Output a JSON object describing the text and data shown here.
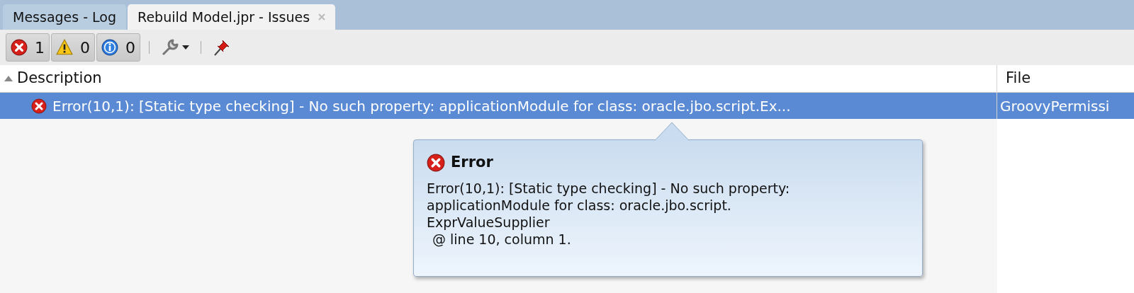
{
  "tabs": [
    {
      "label": "Messages - Log",
      "selected": false,
      "closable": false
    },
    {
      "label": "Rebuild Model.jpr - Issues",
      "selected": true,
      "closable": true
    }
  ],
  "toolbar": {
    "filters": [
      {
        "kind": "error",
        "count": "1"
      },
      {
        "kind": "warning",
        "count": "0"
      },
      {
        "kind": "info",
        "count": "0"
      }
    ]
  },
  "table": {
    "columns": [
      {
        "label": "Description",
        "sorted": true
      },
      {
        "label": "File",
        "sorted": false
      }
    ],
    "rows": [
      {
        "kind": "error",
        "selected": true,
        "cells": [
          "Error(10,1): [Static type checking] - No such property: applicationModule for class: oracle.jbo.script.Ex...",
          "GroovyPermissi"
        ]
      }
    ]
  },
  "tooltip": {
    "kind": "error",
    "title": "Error",
    "lines": [
      "Error(10,1): [Static type checking] - No such property:",
      "applicationModule for class: oracle.jbo.script.",
      "ExprValueSupplier",
      "@ line 10, column 1."
    ]
  }
}
